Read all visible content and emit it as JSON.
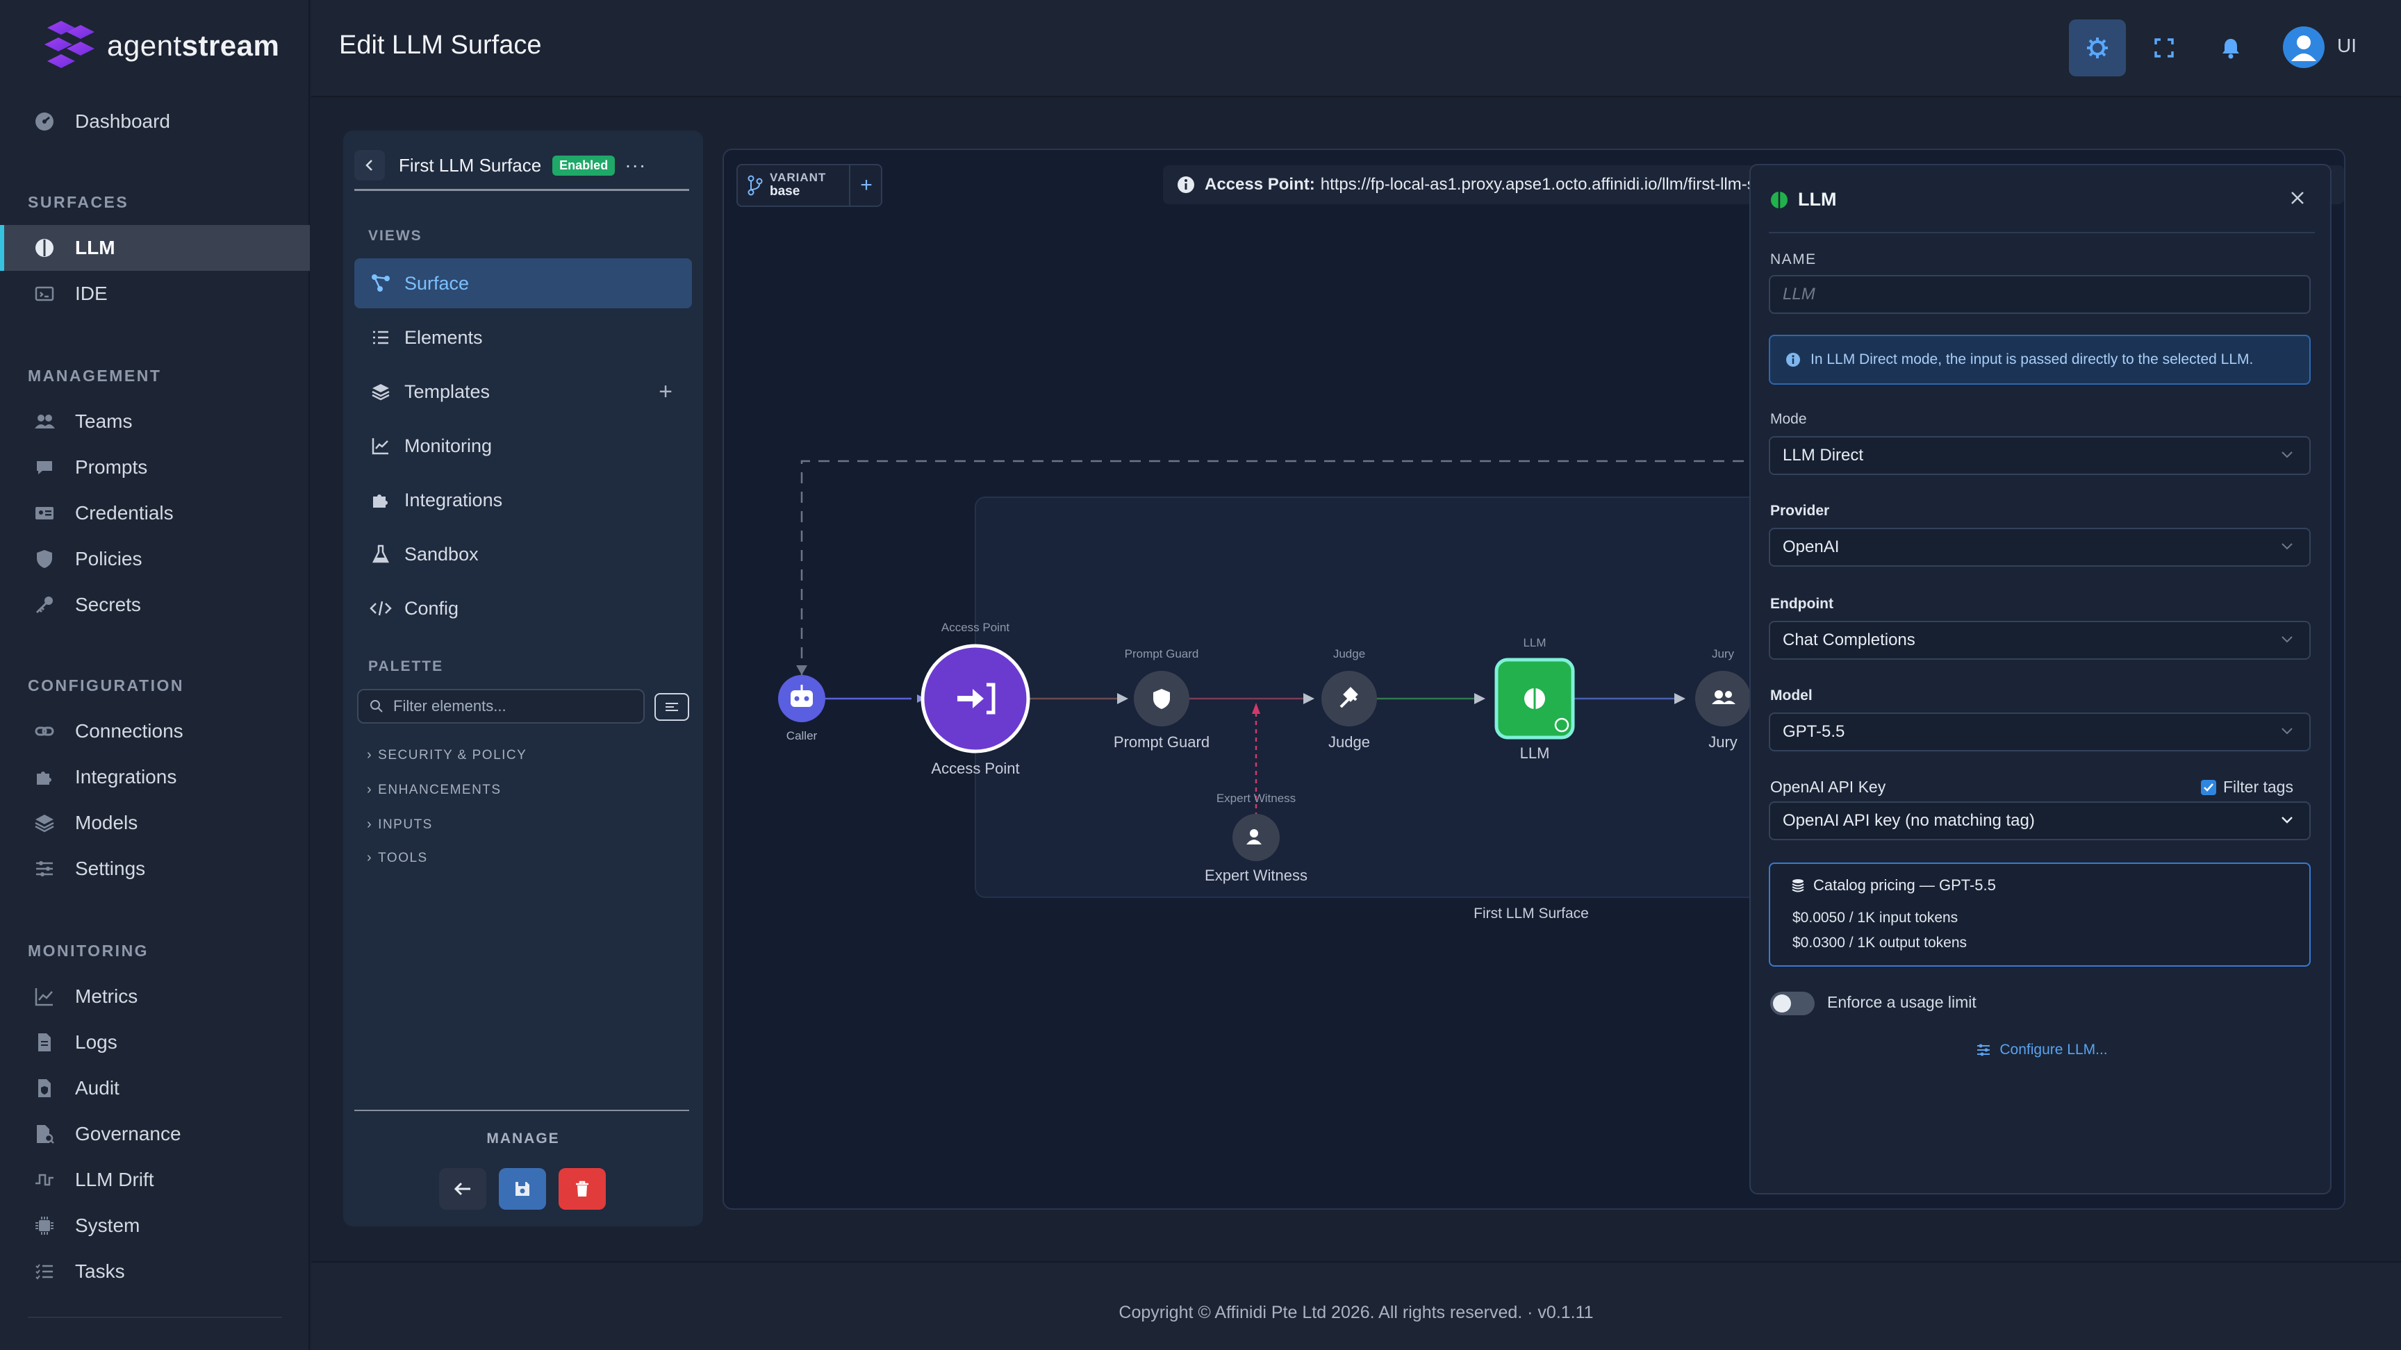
{
  "app": {
    "logo_text_light": "agent",
    "logo_text_bold": "stream",
    "page_title": "Edit LLM Surface",
    "user_initials": "UI"
  },
  "sidebar": {
    "dashboard": "Dashboard",
    "sections": {
      "surfaces": "SURFACES",
      "management": "MANAGEMENT",
      "configuration": "CONFIGURATION",
      "monitoring": "MONITORING"
    },
    "surfaces": [
      "LLM",
      "IDE"
    ],
    "management": [
      "Teams",
      "Prompts",
      "Credentials",
      "Policies",
      "Secrets"
    ],
    "configuration": [
      "Connections",
      "Integrations",
      "Models",
      "Settings"
    ],
    "monitoring": [
      "Metrics",
      "Logs",
      "Audit",
      "Governance",
      "LLM Drift",
      "System",
      "Tasks"
    ]
  },
  "panel": {
    "surface_name": "First LLM Surface",
    "badge": "Enabled",
    "more": "···",
    "views_label": "VIEWS",
    "views": [
      "Surface",
      "Elements",
      "Templates",
      "Monitoring",
      "Integrations",
      "Sandbox",
      "Config"
    ],
    "palette_label": "PALETTE",
    "filter_placeholder": "Filter elements...",
    "palette_groups": [
      "SECURITY & POLICY",
      "ENHANCEMENTS",
      "INPUTS",
      "TOOLS"
    ],
    "manage_label": "MANAGE"
  },
  "canvas": {
    "variant_title": "VARIANT",
    "variant_value": "base",
    "access_label": "Access Point:",
    "access_url": "https://fp-local-as1.proxy.apse1.octo.affinidi.io/llm/first-llm-s",
    "group_label": "First LLM Surface",
    "nodes": {
      "caller": "Caller",
      "access_point_tag": "Access Point",
      "access_point": "Access Point",
      "prompt_guard_tag": "Prompt Guard",
      "prompt_guard": "Prompt Guard",
      "judge_tag": "Judge",
      "judge": "Judge",
      "llm_tag": "LLM",
      "llm": "LLM",
      "jury_tag": "Jury",
      "jury": "Jury",
      "expert_tag": "Expert Witness",
      "expert": "Expert Witness"
    }
  },
  "llm_panel": {
    "title": "LLM",
    "name_label": "NAME",
    "name_placeholder": "LLM",
    "info": "In LLM Direct mode, the input is passed directly to the selected LLM.",
    "mode_label": "Mode",
    "mode_value": "LLM Direct",
    "provider_label": "Provider",
    "provider_value": "OpenAI",
    "endpoint_label": "Endpoint",
    "endpoint_value": "Chat Completions",
    "model_label": "Model",
    "model_value": "GPT-5.5",
    "api_key_label": "OpenAI API Key",
    "filter_tags_label": "Filter tags",
    "filter_tags_checked": true,
    "api_key_value": "OpenAI API key (no matching tag)",
    "pricing_title": "Catalog pricing — GPT-5.5",
    "pricing_input": "$0.0050 / 1K input tokens",
    "pricing_output": "$0.0300 / 1K output tokens",
    "usage_limit_label": "Enforce a usage limit",
    "usage_limit_on": false,
    "configure_link": "Configure LLM..."
  },
  "footer": {
    "copyright": "Copyright © Affinidi Pte Ltd 2026. All rights reserved. · v0.1.11"
  },
  "colors": {
    "accent": "#35c3e0",
    "brand_purple": "#8a3ff0",
    "enabled_green": "#1fa868",
    "llm_node_green": "#22b14c",
    "delete_red": "#e23b3b",
    "save_blue": "#3a6fb5",
    "link_blue": "#5aa3f0"
  }
}
